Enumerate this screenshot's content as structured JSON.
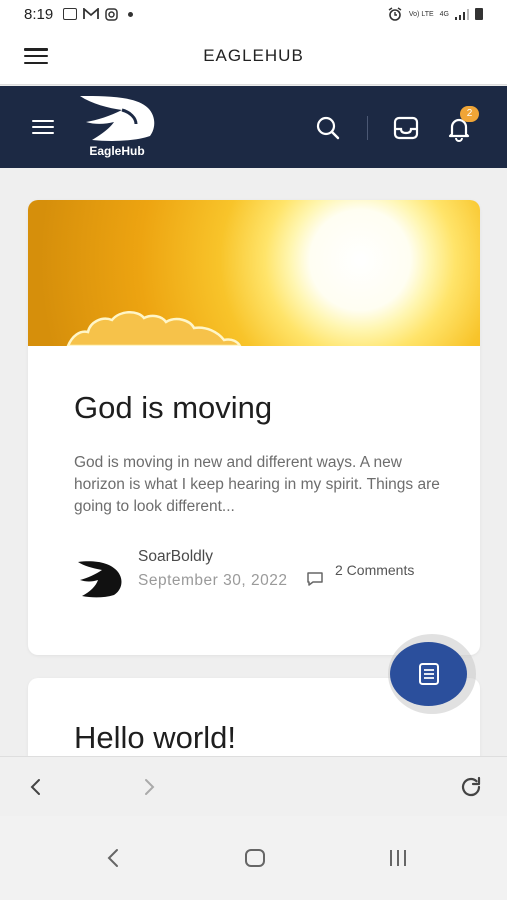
{
  "status_bar": {
    "time": "8:19",
    "left_icons": [
      "gallery-icon",
      "gmail-icon",
      "instagram-icon",
      "dot-icon"
    ],
    "right_icons": [
      "alarm-icon",
      "volte-icon",
      "4g-icon",
      "signal-icon",
      "battery-icon"
    ],
    "volte_label": "Vo) LTE",
    "network_label": "4G"
  },
  "app_bar": {
    "title": "EAGLEHUB"
  },
  "site_header": {
    "logo_text": "EagleHub",
    "notification_count": "2",
    "bg_color": "#1c2944",
    "badge_color": "#f0a537"
  },
  "posts": [
    {
      "title": "God is moving",
      "excerpt": "God is moving in new and different ways. A new horizon is what I keep hearing in my spirit. Things are going to look different...",
      "author": "SoarBoldly",
      "date": "September 30, 2022",
      "comments": "2 Comments"
    },
    {
      "title": "Hello world!"
    }
  ],
  "fab": {
    "color": "#2b4f9c",
    "icon": "document-icon"
  }
}
